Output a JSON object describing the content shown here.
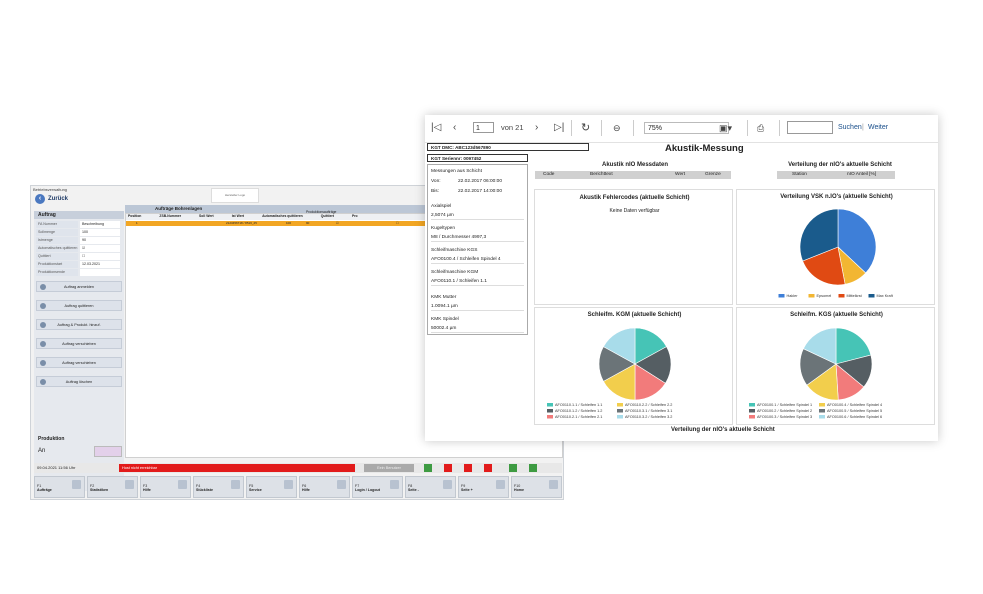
{
  "app": {
    "title": "Betriebsverwaltung",
    "back_label": "Zurück",
    "logo_text": "Hersteller Logo",
    "table_title": "Aufträge Bohrenlagen",
    "right_title": "Er",
    "grid_columns": [
      "Position",
      "ZSB-Nummer",
      "Soll Wert",
      "Ist Wert",
      "Automatisches quittieren",
      "Quittiert",
      "Pro"
    ],
    "grid_subtitle": "Produktionsaufträge",
    "orange_row": [
      "1",
      "2123456718 / 8516_25",
      "100",
      "90",
      "☑",
      "☐"
    ],
    "auftrag": {
      "title": "Auftrag",
      "fields": [
        {
          "label": "FA Nummer",
          "value": "Beschreibung"
        },
        {
          "label": "Sollmenge",
          "value": "100"
        },
        {
          "label": "Istmenge",
          "value": "90"
        },
        {
          "label": "Automatisches quittieren",
          "value": "☑"
        },
        {
          "label": "Quittiert",
          "value": "☐"
        },
        {
          "label": "Produktionstart",
          "value": "12.03.2021"
        },
        {
          "label": "Produktionsende",
          "value": ""
        }
      ],
      "buttons": [
        "Auftrag anmelden",
        "Auftrag quittieren",
        "Auftrag & Produkt. hinzuf.",
        "Auftrag verschieben",
        "Auftrag verschieben",
        "Auftrag löschen"
      ]
    },
    "produktion": {
      "title": "Produktion",
      "state": "An"
    },
    "status": {
      "date": "09.04.2021 11:56 Uhr",
      "message": "Host nicht erreichbar",
      "grey_label": "Eein Benutzer"
    },
    "fkeys": [
      {
        "key": "F1",
        "label": "Aufträge"
      },
      {
        "key": "F2",
        "label": "Statistiken"
      },
      {
        "key": "F3",
        "label": "Hilfe"
      },
      {
        "key": "F4",
        "label": "Stückliste"
      },
      {
        "key": "F5",
        "label": "Service"
      },
      {
        "key": "F6",
        "label": "Hilfe"
      },
      {
        "key": "F7",
        "label": "Login / Logout"
      },
      {
        "key": "F8",
        "label": "Seite -"
      },
      {
        "key": "F9",
        "label": "Seite +"
      },
      {
        "key": "F10",
        "label": "Home"
      }
    ]
  },
  "report": {
    "toolbar": {
      "page_value": "1",
      "page_of": "von 21",
      "zoom": "75%",
      "search_label": "Suchen",
      "separator": "|",
      "next_label": "Weiter"
    },
    "dmc": "KGT DMC: ABC123d567890",
    "serial": "KGT Seriennr: 0097452",
    "title": "Akustik-Messung",
    "info": {
      "measurements_label": "Messungen aus Schicht",
      "von_label": "Von:",
      "von_value": "22.02.2017 06:00:00",
      "bis_label": "Bis:",
      "bis_value": "22.02.2017 14:00:00",
      "axialspiel_label": "Axialspiel",
      "axialspiel_value": "2,5074 µm",
      "kugeltyp_label": "Kugeltypen",
      "kugeltyp_value": "M8 / Durchmesser 4997,3",
      "kgs_label": "Schleifmaschine KGS",
      "kgs_value": "AFO0100.4 / Schleifen Spindel 4",
      "kgm_label": "Schleifmaschine KGM",
      "kgm_value": "AFO0110.1 / Schleifen 1.1",
      "mutter_label": "KMK Mutter",
      "mutter_value": "1.0094.1 µm",
      "spindel_label": "KMK Spindel",
      "spindel_value": "50002.4 µm"
    },
    "messdaten": {
      "title": "Akustik nIO Messdaten",
      "columns": [
        "Code",
        "Berichttext",
        "Wert",
        "Grenze"
      ]
    },
    "fehlercodes": {
      "title": "Akustik Fehlercodes (aktuelle Schicht)",
      "empty": "Keine Daten verfügbar"
    },
    "verteilung": {
      "title": "Verteilung der nIO's aktuelle Schicht",
      "columns": [
        "Station",
        "nIO Anteil [%]"
      ]
    },
    "bottom_title": "Verteilung der nIO's aktuelle Schicht"
  },
  "chart_data": [
    {
      "type": "pie",
      "title": "Verteilung VSK n.IO's (aktuelle Schicht)",
      "categories": [
        "Hakler",
        "Epsomel",
        "Mittelkrst",
        "Max Kraft"
      ],
      "values": [
        37,
        10,
        22,
        31
      ],
      "colors": [
        "#3e7fd8",
        "#f2b632",
        "#e04a13",
        "#1a5b8c"
      ]
    },
    {
      "type": "pie",
      "title": "Schleifm. KGM (aktuelle Schicht)",
      "categories": [
        "AFO0110.1.1 / Schleifen 1.1",
        "AFO0110.1.2 / Schleifen 1.2",
        "AFO0110.2.1 / Schleifen 2.1",
        "AFO0110.2.2 / Schleifen 2.2",
        "AFO0110.3.1 / Schleifen 3.1",
        "AFO0110.3.2 / Schleifen 3.2"
      ],
      "values": [
        17,
        17,
        16,
        17,
        16,
        17
      ],
      "colors": [
        "#46c4b6",
        "#555e63",
        "#f27b7b",
        "#f2ce4c",
        "#6b7478",
        "#a8dcea"
      ]
    },
    {
      "type": "pie",
      "title": "Schleifm. KGS (aktuelle Schicht)",
      "categories": [
        "AFO0100.1 / Schleifen Spindel 1",
        "AFO0100.2 / Schleifen Spindel 2",
        "AFO0100.3 / Schleifen Spindel 3",
        "AFO0100.4 / Schleifen Spindel 4",
        "AFO0100.5 / Schleifen Spindel 5",
        "AFO0100.6 / Schleifen Spindel 6"
      ],
      "values": [
        21,
        15,
        13,
        16,
        17,
        18
      ],
      "colors": [
        "#46c4b6",
        "#555e63",
        "#f27b7b",
        "#f2ce4c",
        "#6b7478",
        "#a8dcea"
      ]
    }
  ]
}
